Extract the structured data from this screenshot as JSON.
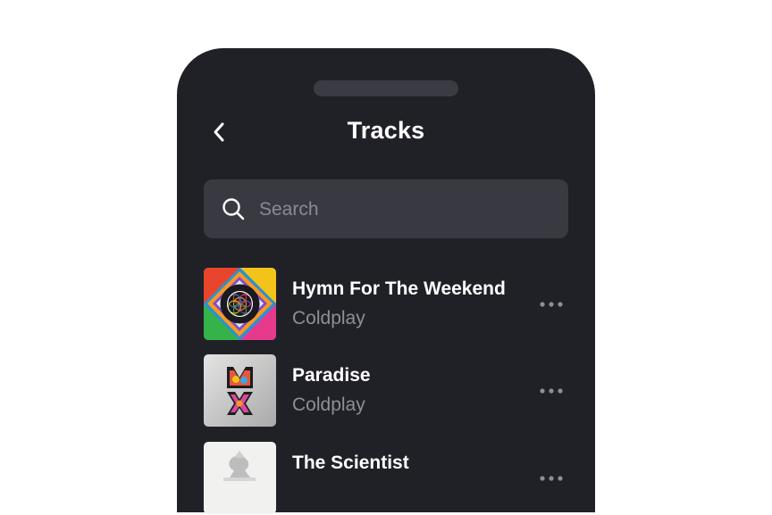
{
  "header": {
    "title": "Tracks",
    "back_icon": "chevron-left-icon"
  },
  "search": {
    "placeholder": "Search",
    "value": "",
    "icon": "search-icon"
  },
  "tracks": [
    {
      "title": "Hymn For The Weekend",
      "artist": "Coldplay",
      "cover": "album-cover-flower-of-life"
    },
    {
      "title": "Paradise",
      "artist": "Coldplay",
      "cover": "album-cover-mylo-xyloto"
    },
    {
      "title": "The Scientist",
      "artist": "",
      "cover": "album-cover-rush-of-blood"
    }
  ],
  "more_icon": "more-horizontal-icon",
  "colors": {
    "background": "#ffffff",
    "phone": "#202027",
    "search_field": "#393942",
    "primary_text": "#ffffff",
    "secondary_text": "#8e8e96"
  }
}
